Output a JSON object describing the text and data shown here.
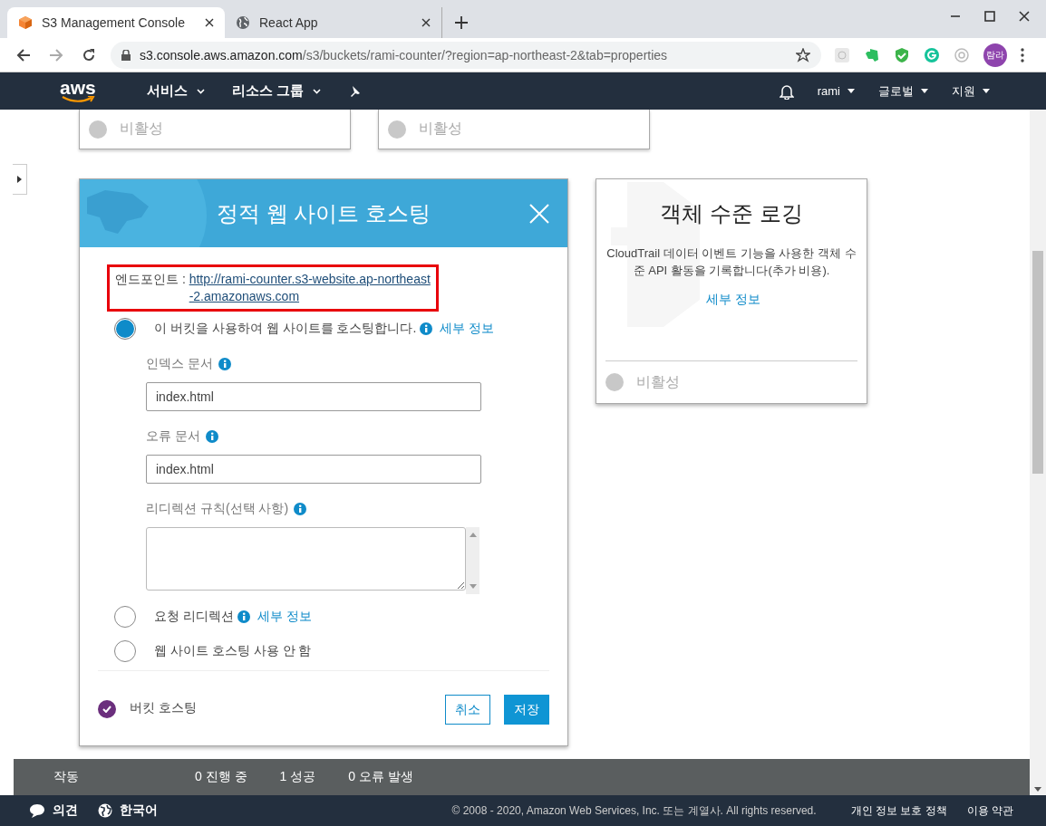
{
  "browser": {
    "tabs": [
      {
        "title": "S3 Management Console",
        "selected": true,
        "kind": "aws"
      },
      {
        "title": "React App",
        "selected": false,
        "kind": "globe"
      }
    ],
    "url": {
      "host": "s3.console.aws.amazon.com",
      "path": "/s3/buckets/rami-counter/?region=ap-northeast-2&tab=properties"
    },
    "profile": "람라"
  },
  "nav": {
    "logo": "aws",
    "menus": [
      "서비스",
      "리소스 그룹"
    ],
    "user": "rami",
    "region": "글로벌",
    "support": "지원"
  },
  "top_cards": [
    {
      "status": "비활성",
      "enabled": false
    },
    {
      "status": "비활성",
      "enabled": false
    }
  ],
  "hosting_dialog": {
    "title": "정적 웹 사이트 호스팅",
    "endpoint_label": "엔드포인트 : ",
    "endpoint_url": "http://rami-counter.s3-website.ap-northeast-2.amazonaws.com",
    "highlighted": true,
    "options": [
      {
        "label": "이 버킷을 사용하여 웹 사이트를 호스팅합니다.",
        "selected": true,
        "link": "세부 정보",
        "fields": [
          {
            "kind": "input",
            "label": "인덱스 문서",
            "value": "index.html"
          },
          {
            "kind": "input",
            "label": "오류 문서",
            "value": "index.html"
          },
          {
            "kind": "textarea",
            "label": "리디렉션 규칙(선택 사항)"
          }
        ]
      },
      {
        "label": "요청 리디렉션",
        "selected": false,
        "link": "세부 정보"
      },
      {
        "label": "웹 사이트 호스팅 사용 안 함",
        "selected": false
      }
    ],
    "summary": {
      "label": "버킷 호스팅",
      "checked": true
    },
    "buttons": [
      {
        "kind": "secondary",
        "label": "취소"
      },
      {
        "kind": "primary",
        "label": "저장"
      }
    ]
  },
  "logging_card": {
    "title": "객체 수준 로깅",
    "description": "CloudTrail 데이터 이벤트 기능을 사용한 객체 수준 API 활동을 기록합니다(추가 비용).",
    "link": "세부 정보",
    "status": "비활성",
    "enabled": false
  },
  "status_bar": {
    "label": "작동",
    "counts": [
      "0 진행 중",
      "1 성공",
      "0 오류 발생"
    ]
  },
  "footer": {
    "feedback": "의견",
    "language": "한국어",
    "copyright": "© 2008 - 2020, Amazon Web Services, Inc. 또는 계열사. All rights reserved.",
    "links": [
      "개인 정보 보호 정책",
      "이용 약관"
    ]
  }
}
